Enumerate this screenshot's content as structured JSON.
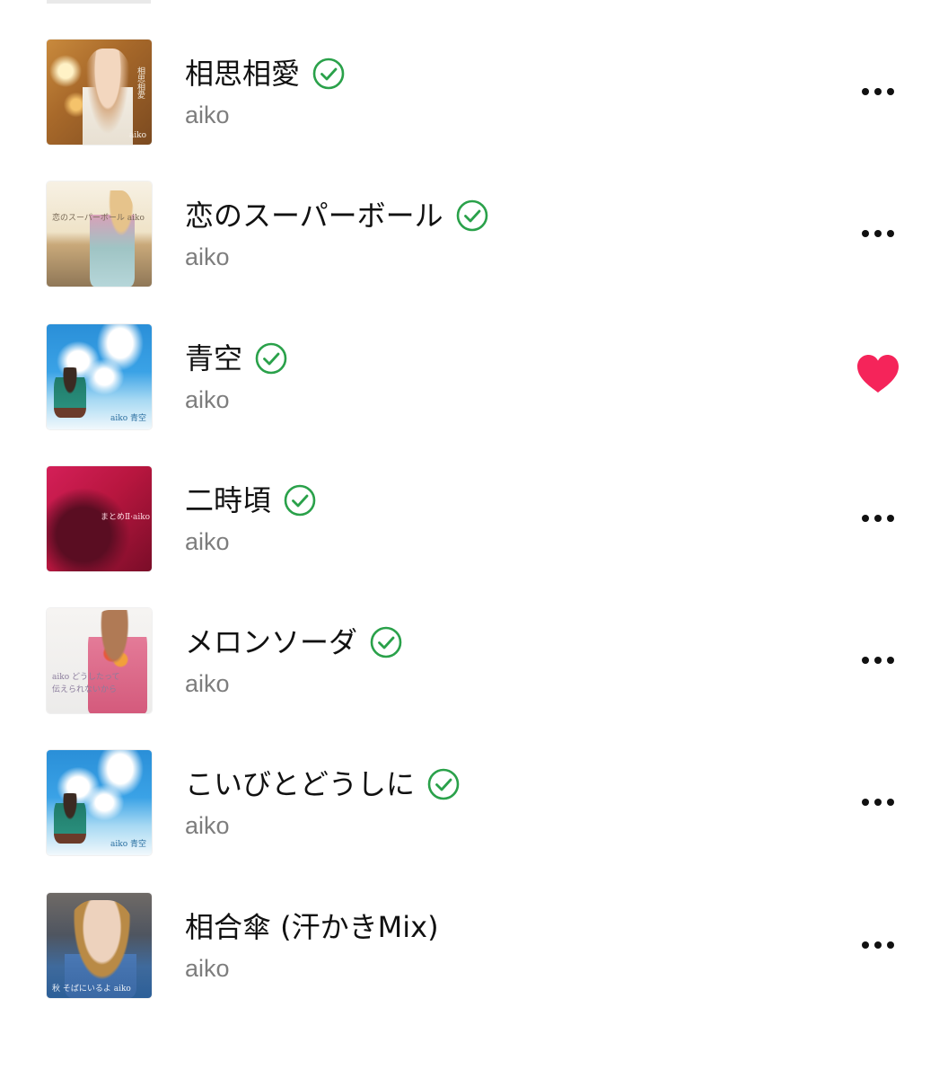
{
  "colors": {
    "check": "#2aa14a",
    "heart": "#f5245a",
    "title": "#111111",
    "artist": "#7d7d7d"
  },
  "tracks": [
    {
      "title": "相思相愛",
      "artist": "aiko",
      "downloaded": true,
      "action": "more-icon",
      "art": "art-warm",
      "art_label": "aiko",
      "art_label_v": "相思相愛"
    },
    {
      "title": "恋のスーパーボール",
      "artist": "aiko",
      "downloaded": true,
      "action": "more-icon",
      "art": "art-rooftop",
      "art_label": "恋のスーパーボール aiko"
    },
    {
      "title": "青空",
      "artist": "aiko",
      "downloaded": true,
      "action": "heart-icon",
      "art": "art-sky",
      "art_label": "aiko 青空"
    },
    {
      "title": "二時頃",
      "artist": "aiko",
      "downloaded": true,
      "action": "more-icon",
      "art": "art-magenta",
      "art_label": "まとめⅡ·aiko"
    },
    {
      "title": "メロンソーダ",
      "artist": "aiko",
      "downloaded": true,
      "action": "more-icon",
      "art": "art-pale",
      "art_label": "aiko どうしたって伝えられないから"
    },
    {
      "title": "こいびとどうしに",
      "artist": "aiko",
      "downloaded": true,
      "action": "more-icon",
      "art": "art-sky",
      "art_label": "aiko 青空"
    },
    {
      "title": "相合傘 (汗かきMix)",
      "artist": "aiko",
      "downloaded": false,
      "action": "more-icon",
      "art": "art-denim",
      "art_label": "秋 そばにいるよ aiko"
    }
  ]
}
